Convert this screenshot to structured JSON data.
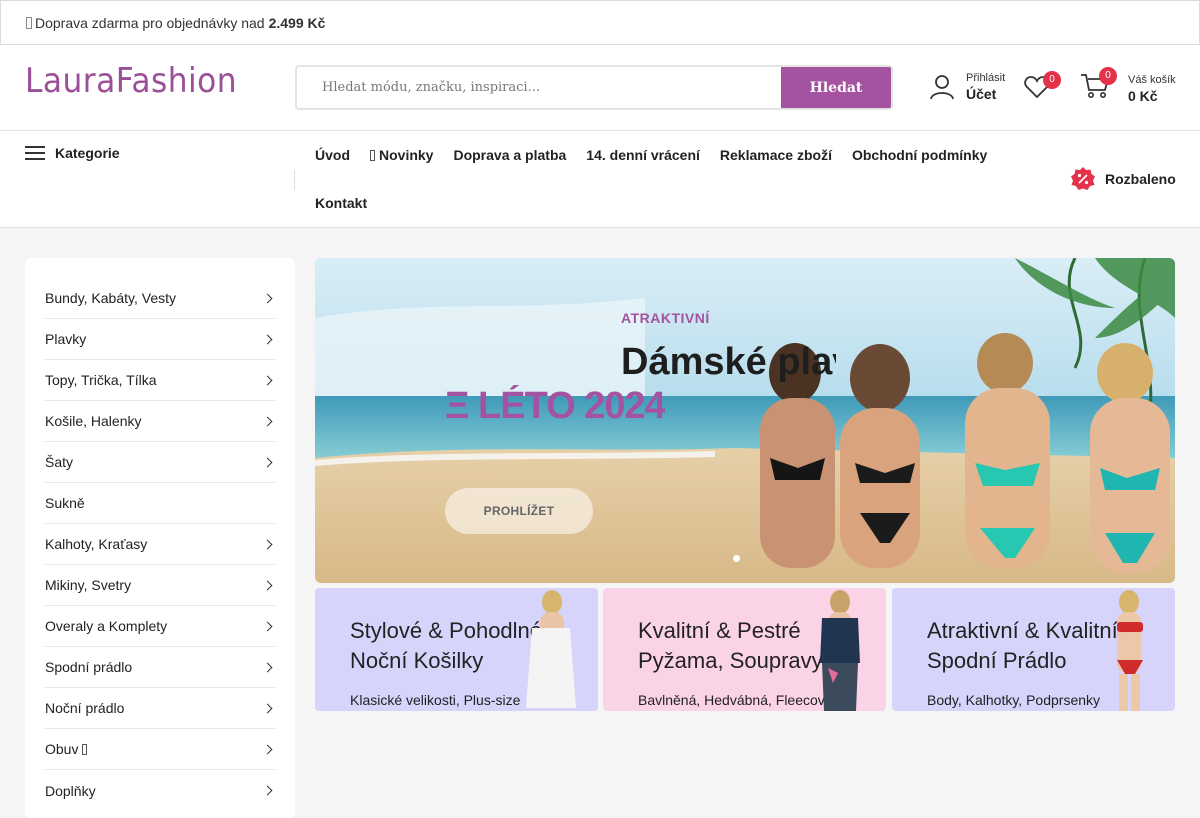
{
  "topbar": {
    "text": "Doprava zdarma pro objednávky nad",
    "amount": "2.499 Kč"
  },
  "header": {
    "logo": "LauraFashion",
    "search": {
      "placeholder": "Hledat módu, značku, inspiraci...",
      "button": "Hledat"
    },
    "account": {
      "small": "Přihlásit",
      "label": "Účet"
    },
    "wishlist_count": "0",
    "cart": {
      "small": "Váš košík",
      "label": "0 Kč",
      "count": "0"
    }
  },
  "nav": {
    "categories_label": "Kategorie",
    "menu": [
      "Úvod",
      "Novinky",
      "Doprava a platba",
      "14. denní vrácení",
      "Reklamace zboží",
      "Obchodní podmínky",
      "Kontakt"
    ],
    "unboxed": "Rozbaleno"
  },
  "sidebar": {
    "items": [
      {
        "label": "Bundy, Kabáty, Vesty",
        "has_sub": true
      },
      {
        "label": "Plavky",
        "has_sub": true
      },
      {
        "label": "Topy, Trička, Tílka",
        "has_sub": true
      },
      {
        "label": "Košile, Halenky",
        "has_sub": true
      },
      {
        "label": "Šaty",
        "has_sub": true
      },
      {
        "label": "Sukně",
        "has_sub": false
      },
      {
        "label": "Kalhoty, Kraťasy",
        "has_sub": true
      },
      {
        "label": "Mikiny, Svetry",
        "has_sub": true
      },
      {
        "label": "Overaly a Komplety",
        "has_sub": true
      },
      {
        "label": "Spodní prádlo",
        "has_sub": true
      },
      {
        "label": "Noční prádlo",
        "has_sub": true
      },
      {
        "label": "Obuv",
        "has_sub": true
      },
      {
        "label": "Doplňky",
        "has_sub": true
      }
    ]
  },
  "hero": {
    "eyebrow": "ATRAKTIVNÍ",
    "title": "Dámské plavky",
    "subtitle": "LÉTO 2024",
    "button": "PROHLÍŽET"
  },
  "promos": [
    {
      "title1": "Stylové & Pohodlné",
      "title2": "Noční Košilky",
      "sub": "Klasické velikosti, Plus-size",
      "bg": "#d6d4fb"
    },
    {
      "title1": "Kvalitní & Pestré",
      "title2": "Pyžama, Soupravy",
      "sub": "Bavlněná, Hedvábná, Fleecová",
      "bg": "#fbd3e6"
    },
    {
      "title1": "Atraktivní & Kvalitní",
      "title2": "Spodní Prádlo",
      "sub": "Body, Kalhotky, Podprsenky",
      "bg": "#d6d4fb"
    }
  ],
  "colors": {
    "accent": "#a353a0",
    "badge": "#e3324a"
  }
}
